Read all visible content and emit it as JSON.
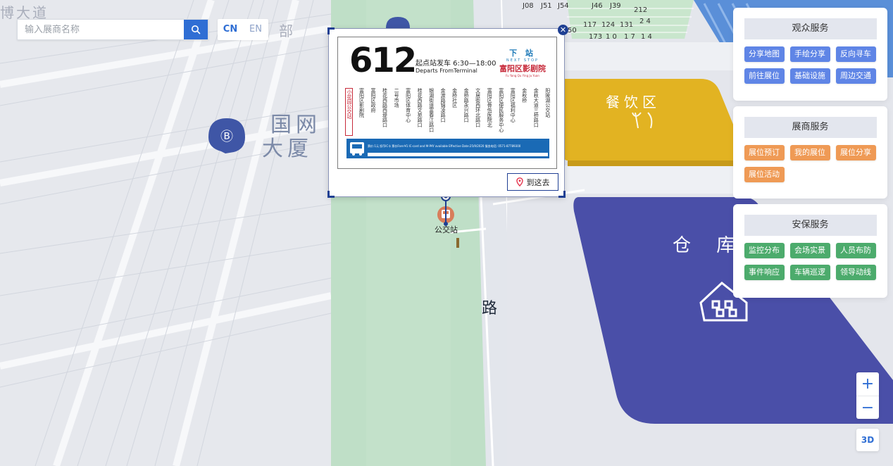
{
  "search": {
    "placeholder": "输入展商名称"
  },
  "language": {
    "cn": "CN",
    "en": "EN",
    "active": "CN"
  },
  "map": {
    "labels": {
      "road_top_left": "博大道",
      "road_bottom": "路",
      "building_name_line1": "国网",
      "building_name_line2": "大厦",
      "top_partial": "部",
      "food_zone": "餐饮区",
      "warehouse": "仓 库",
      "bus_station": "公交站"
    },
    "top_numbers": [
      "J08",
      "J51",
      "J54",
      "J46",
      "J39",
      "212",
      "2 4",
      "50",
      "117",
      "124",
      "131",
      "173",
      "1 0",
      "1 7",
      "1 4"
    ]
  },
  "popup": {
    "route_number": "612",
    "depart_cn": "起点站发车 6:30—18:00",
    "depart_en": "Departs FromTerminal",
    "next_cn": "下 站",
    "next_en": "NEXT STOP",
    "next_stop": "富阳区影剧院",
    "next_stop_pinyin": "Fu Yang Qu Ying Ju Yuan",
    "stops": [
      "小花园公交站",
      "富阳区影剧院",
      "富阳区政府",
      "桂花西路西堤路口",
      "二号市场",
      "富阳区体育中心",
      "桂花西路文苑路口",
      "银湖街道富春江路口",
      "金渡路锦凌路口",
      "金桥社区",
      "金桥路永兴路口",
      "文居街西环北路口",
      "富阳区骨伤医院北",
      "富阳区便民服务中心",
      "富阳区福利中心",
      "金秋桥",
      "金秋大道三桥路口",
      "阳陂湖公交站"
    ],
    "current_stop_index": 0,
    "fare_text": "票价:1元  投币IC卡  票价Fare:¥1 IC-card and M-PAY available  Effective Date:25/9/2020  服务电话: 0571-87789300",
    "goto_label": "到这去",
    "close_icon": "close-icon"
  },
  "panels": [
    {
      "title": "观众服务",
      "color": "#5f85e6",
      "buttons": [
        "分享地图",
        "手绘分享",
        "反向寻车",
        "前往展位",
        "基础设施",
        "周边交通"
      ]
    },
    {
      "title": "展商服务",
      "color": "#ef9a55",
      "buttons": [
        "展位预订",
        "我的展位",
        "展位分享",
        "展位活动"
      ]
    },
    {
      "title": "安保服务",
      "color": "#4cab6c",
      "buttons": [
        "监控分布",
        "会场实景",
        "人员布防",
        "事件响应",
        "车辆巡逻",
        "领导动线"
      ]
    }
  ],
  "zoom": {
    "in": "+",
    "out": "−"
  },
  "view_toggle": "3D",
  "colors": {
    "accent": "#2f6ed4",
    "food_zone": "#e2b322",
    "warehouse": "#4a4fa8",
    "green_area": "#bfdfc7",
    "popup_border": "#1f3f93"
  }
}
